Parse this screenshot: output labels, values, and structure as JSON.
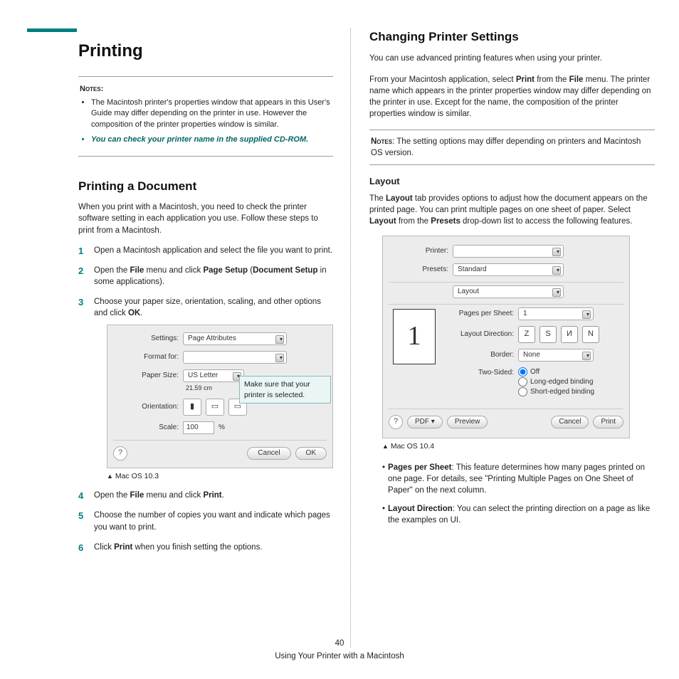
{
  "left": {
    "heading": "Printing",
    "notes_label": "Notes",
    "notes": [
      "The Macintosh printer's properties window that appears in this User's Guide may differ depending on the printer in use. However the composition of the printer properties window is similar.",
      "You can check your printer name in the supplied CD-ROM."
    ],
    "sub_heading": "Printing a Document",
    "intro": "When you print with a Macintosh, you need to check the printer software setting in each application you use. Follow these steps to print from a Macintosh.",
    "step1": "Open a Macintosh application and select the file you want to print.",
    "step2a": "Open the ",
    "step2b": " menu and click ",
    "step2c": " (",
    "step2d": " in some applications).",
    "step2_bold1": "File",
    "step2_bold2": "Page Setup",
    "step2_bold3": "Document Setup",
    "step3a": "Choose your paper size, orientation, scaling, and other options and click ",
    "step3_bold": "OK",
    "step3b": ".",
    "fig1": {
      "settings_label": "Settings:",
      "settings_value": "Page Attributes",
      "format_label": "Format for:",
      "format_value": "",
      "paper_label": "Paper Size:",
      "paper_value": "US Letter",
      "paper_sub": "21.59 cm",
      "orient_label": "Orientation:",
      "orient_a": "⬆",
      "orient_b": "⬌",
      "orient_c": "⬌",
      "scale_label": "Scale:",
      "scale_value": "100",
      "scale_unit": "%",
      "help": "?",
      "cancel": "Cancel",
      "ok": "OK",
      "tooltip": "Make sure that your printer is selected.",
      "caption_pre": "▲",
      "caption": "Mac OS 10.3"
    },
    "step4a": "Open the ",
    "step4_bold1": "File",
    "step4b": " menu and click ",
    "step4_bold2": "Print",
    "step4c": ".",
    "step5": "Choose the number of copies you want and indicate which pages you want to print.",
    "step6a": "Click ",
    "step6_bold": "Print",
    "step6b": " when you finish setting the options."
  },
  "right": {
    "heading": "Changing Printer Settings",
    "p1": "You can use advanced printing features when using your printer.",
    "p2a": "From your Macintosh application, select ",
    "p2b": " from the ",
    "p2c": " menu. The printer name which appears in the printer properties window may differ depending on the printer in use. Except for the name, the composition of the printer properties window is similar.",
    "p2_bold1": "Print",
    "p2_bold2": "File",
    "notes_label": "Notes",
    "notes_text": ": The setting options may differ depending on printers and Macintosh OS version.",
    "layout_h": "Layout",
    "layout_pa": "The ",
    "layout_pb": " tab provides options to adjust how the document appears on the printed page. You can print multiple pages on one sheet of paper. Select ",
    "layout_pc": " from the ",
    "layout_pd": " drop-down list to access the following features.",
    "layout_b1": "Layout",
    "layout_b2": "Layout",
    "layout_b3": "Presets",
    "fig2": {
      "printer_label": "Printer:",
      "printer_value": "",
      "presets_label": "Presets:",
      "presets_value": "Standard",
      "tab_value": "Layout",
      "pps_label": "Pages per Sheet:",
      "pps_value": "1",
      "dir_label": "Layout Direction:",
      "border_label": "Border:",
      "border_value": "None",
      "two_label": "Two-Sided:",
      "opt_off": "Off",
      "opt_long": "Long-edged binding",
      "opt_short": "Short-edged binding",
      "page_icon": "1",
      "help": "?",
      "pdf": "PDF ▾",
      "preview": "Preview",
      "cancel": "Cancel",
      "print": "Print",
      "caption_pre": "▲",
      "caption": "Mac OS 10.4"
    },
    "bullets": {
      "b1_label": "Pages per Sheet",
      "b1_text": ": This feature determines how many pages printed on one page. For details, see \"Printing Multiple Pages on One Sheet of Paper\" on the next column.",
      "b2_label": "Layout Direction",
      "b2_text": ": You can select the printing direction on a page as like the examples on UI."
    }
  },
  "footer": {
    "page": "40",
    "title": "Using Your Printer with a Macintosh"
  }
}
